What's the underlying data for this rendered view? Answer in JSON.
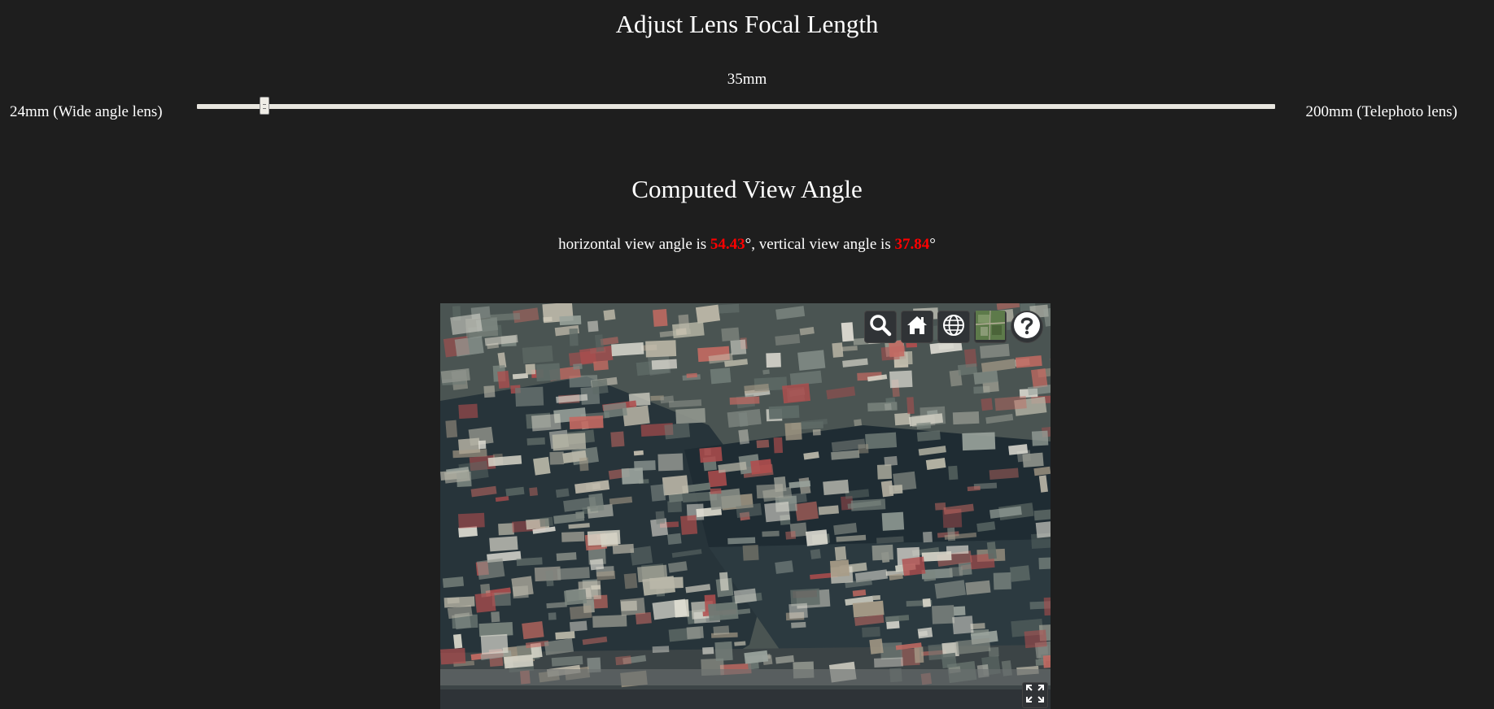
{
  "header": {
    "title": "Adjust Lens Focal Length"
  },
  "slider": {
    "current_label": "35mm",
    "min_label": "24mm (Wide angle lens)",
    "max_label": "200mm (Telephoto lens)",
    "min": 24,
    "max": 200,
    "value": 35
  },
  "result": {
    "title": "Computed View Angle",
    "prefix": "horizontal view angle is ",
    "horizontal_value": "54.43",
    "middle": "°, vertical view angle is ",
    "vertical_value": "37.84",
    "suffix": "°",
    "highlight_color": "#ff0000"
  },
  "viewer": {
    "toolbar_icons": [
      "search-icon",
      "home-icon",
      "globe-icon",
      "imagery-icon",
      "help-icon"
    ],
    "fullscreen_icon": "fullscreen-icon"
  }
}
